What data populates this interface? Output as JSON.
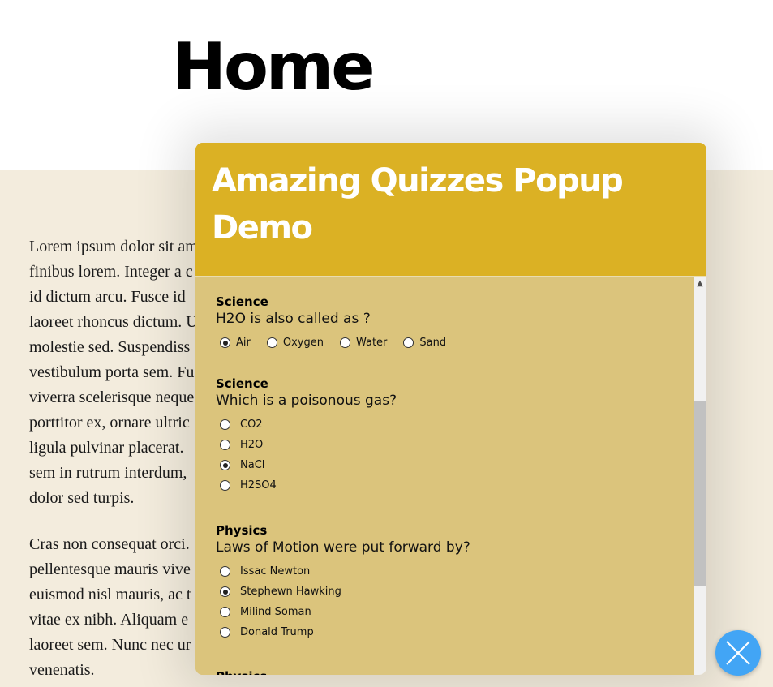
{
  "page": {
    "title": "Home",
    "article": {
      "paragraphs": [
        {
          "lines": [
            "Lorem ipsum dolor sit am",
            "finibus lorem. Integer a c",
            "id dictum arcu. Fusce id",
            "laoreet rhoncus dictum. U",
            "molestie sed. Suspendiss",
            "vestibulum porta sem. Fu",
            "viverra scelerisque neque",
            "porttitor ex, ornare ultric",
            "ligula pulvinar placerat.",
            "sem in rutrum interdum,",
            "dolor sed turpis."
          ]
        },
        {
          "lines": [
            "Cras non consequat orci.",
            "pellentesque mauris vive",
            "euismod nisl mauris, ac t",
            "vitae ex nibh. Aliquam e",
            "laoreet sem. Nunc nec ur",
            "venenatis."
          ]
        }
      ]
    }
  },
  "popup": {
    "title": "Amazing Quizzes Popup Demo",
    "colors": {
      "header": "#dbb124",
      "body": "#dbc47c",
      "close_button": "#42a5f5"
    },
    "questions": [
      {
        "category": "Science",
        "text": "H2O is also called as ?",
        "layout": "inline",
        "options": [
          {
            "label": "Air",
            "selected": true
          },
          {
            "label": "Oxygen",
            "selected": false
          },
          {
            "label": "Water",
            "selected": false
          },
          {
            "label": "Sand",
            "selected": false
          }
        ]
      },
      {
        "category": "Science",
        "text": "Which is a poisonous gas?",
        "layout": "stacked",
        "options": [
          {
            "label": "CO2",
            "selected": false
          },
          {
            "label": "H2O",
            "selected": false
          },
          {
            "label": "NaCl",
            "selected": true
          },
          {
            "label": "H2SO4",
            "selected": false
          }
        ]
      },
      {
        "category": "Physics",
        "text": "Laws of Motion were put forward by?",
        "layout": "stacked",
        "options": [
          {
            "label": "Issac Newton",
            "selected": false
          },
          {
            "label": "Stephewn Hawking",
            "selected": true
          },
          {
            "label": "Milind Soman",
            "selected": false
          },
          {
            "label": "Donald Trump",
            "selected": false
          }
        ]
      },
      {
        "category": "Physics",
        "text": "",
        "layout": "stacked",
        "options": []
      }
    ],
    "scrollbar": {
      "up_arrow_icon": "chevron-up-icon",
      "scroll_position": 0.31
    },
    "close_icon": "close-icon"
  }
}
